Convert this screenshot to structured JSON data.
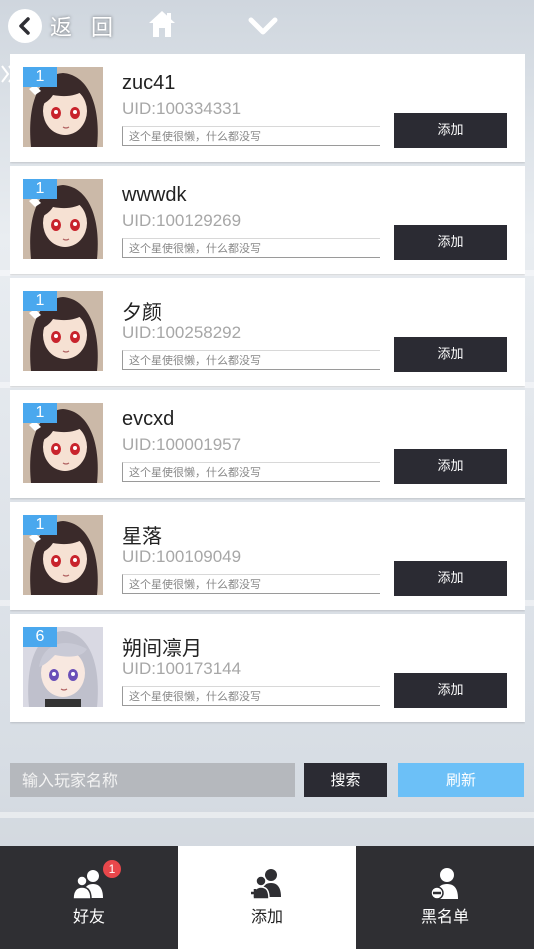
{
  "header": {
    "back_label": "返 回"
  },
  "friends": [
    {
      "level": "1",
      "name": "zuc41",
      "uid": "UID:100334331",
      "signature": "这个星使很懒，什么都没写",
      "add_label": "添加",
      "avatar": "dark-hair-girl"
    },
    {
      "level": "1",
      "name": "wwwdk",
      "uid": "UID:100129269",
      "signature": "这个星使很懒，什么都没写",
      "add_label": "添加",
      "avatar": "dark-hair-girl"
    },
    {
      "level": "1",
      "name": "夕颜",
      "uid": "UID:100258292",
      "signature": "这个星使很懒，什么都没写",
      "add_label": "添加",
      "avatar": "dark-hair-girl"
    },
    {
      "level": "1",
      "name": "evcxd",
      "uid": "UID:100001957",
      "signature": "这个星使很懒，什么都没写",
      "add_label": "添加",
      "avatar": "dark-hair-girl"
    },
    {
      "level": "1",
      "name": "星落",
      "uid": "UID:100109049",
      "signature": "这个星使很懒，什么都没写",
      "add_label": "添加",
      "avatar": "dark-hair-girl"
    },
    {
      "level": "6",
      "name": "朔间凛月",
      "uid": "UID:100173144",
      "signature": "这个星使很懒，什么都没写",
      "add_label": "添加",
      "avatar": "silver-hair-girl"
    }
  ],
  "search": {
    "placeholder": "输入玩家名称",
    "search_label": "搜索",
    "refresh_label": "刷新"
  },
  "nav": {
    "friends_label": "好友",
    "friends_badge": "1",
    "add_label": "添加",
    "blacklist_label": "黑名单"
  },
  "colors": {
    "level_badge": "#4aa8ee",
    "dark_button": "#2b2b33",
    "refresh_button": "#6cc0f7",
    "notification_badge": "#e8474b"
  }
}
